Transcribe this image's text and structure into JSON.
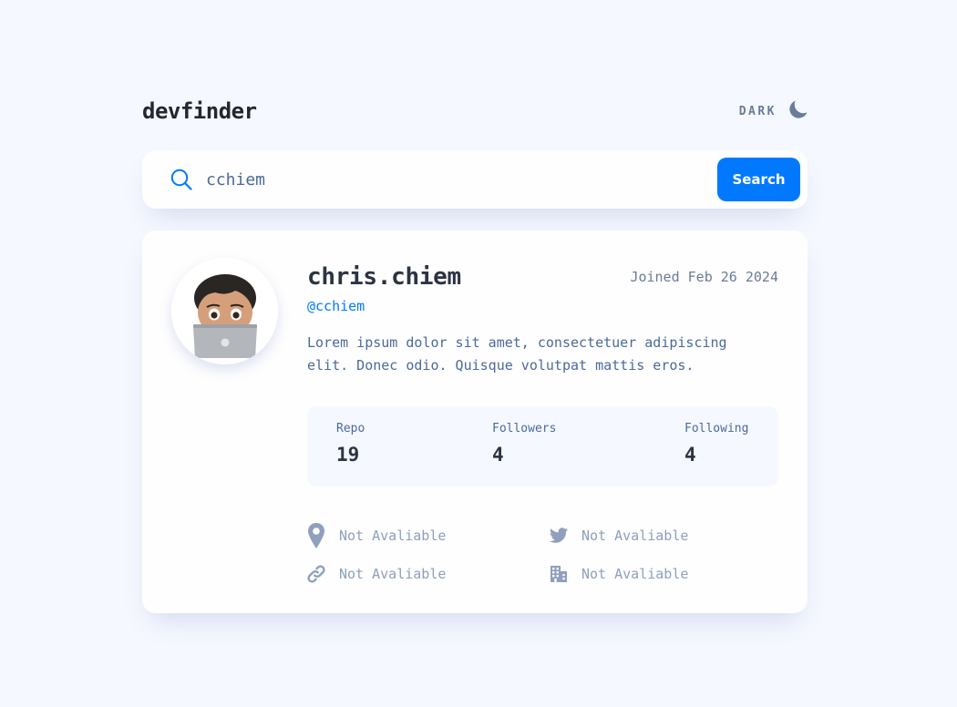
{
  "header": {
    "logo": "devfinder",
    "theme_label": "DARK",
    "theme_icon": "moon-icon"
  },
  "search": {
    "icon": "search-icon",
    "value": "cchiem",
    "placeholder": "",
    "button_label": "Search"
  },
  "profile": {
    "avatar_icon": "avatar",
    "name": "chris.chiem",
    "joined": "Joined Feb 26 2024",
    "login": "@cchiem",
    "bio": "Lorem ipsum dolor sit amet, consectetuer adipiscing elit. Donec odio. Quisque volutpat mattis eros.",
    "stats": [
      {
        "label": "Repo",
        "value": "19"
      },
      {
        "label": "Followers",
        "value": "4"
      },
      {
        "label": "Following",
        "value": "4"
      }
    ],
    "links": {
      "location": {
        "icon": "location-pin-icon",
        "text": "Not Avaliable"
      },
      "twitter": {
        "icon": "twitter-icon",
        "text": "Not Avaliable"
      },
      "blog": {
        "icon": "link-icon",
        "text": "Not Avaliable"
      },
      "company": {
        "icon": "building-icon",
        "text": "Not Avaliable"
      }
    }
  },
  "colors": {
    "accent": "#0079ff",
    "background": "#f5f8fe",
    "card": "#fefefe",
    "text_dark": "#2b3442",
    "text_muted": "#697c9a",
    "text_disabled": "#8fa0bc"
  }
}
